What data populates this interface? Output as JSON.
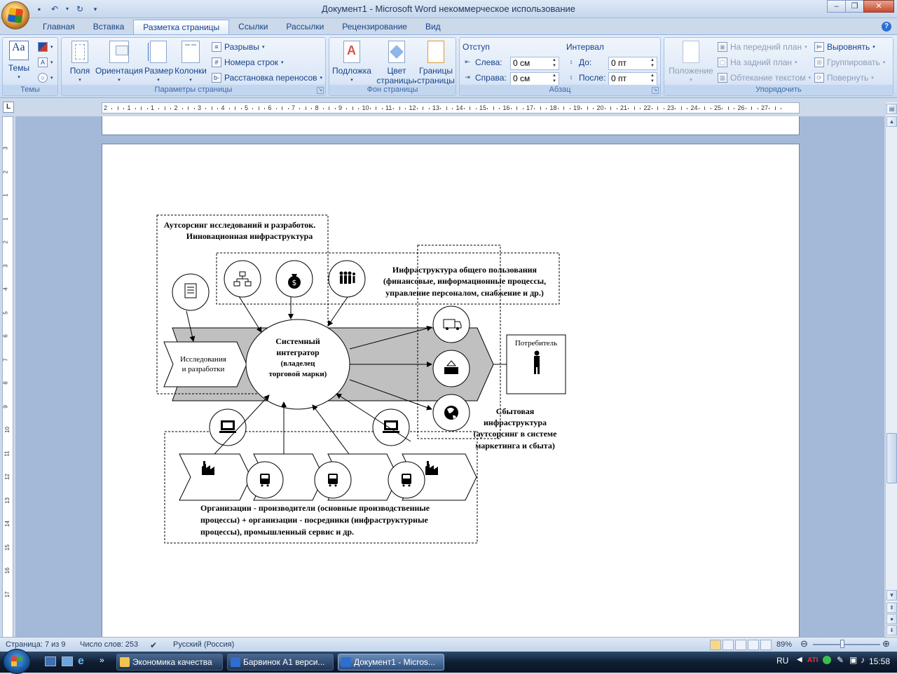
{
  "window": {
    "title": "Документ1 - Microsoft Word некоммерческое использование"
  },
  "ribbon": {
    "tabs": [
      "Главная",
      "Вставка",
      "Разметка страницы",
      "Ссылки",
      "Рассылки",
      "Рецензирование",
      "Вид"
    ],
    "active_tab": "Разметка страницы",
    "themes": {
      "label": "Темы",
      "button": "Темы"
    },
    "page_setup": {
      "label": "Параметры страницы",
      "fields": "Поля",
      "orientation": "Ориентация",
      "size": "Размер",
      "columns": "Колонки",
      "breaks": "Разрывы",
      "line_numbers": "Номера строк",
      "hyphenation": "Расстановка переносов"
    },
    "page_background": {
      "label": "Фон страницы",
      "watermark": "Подложка",
      "page_color_1": "Цвет",
      "page_color_2": "страницы",
      "page_borders_1": "Границы",
      "page_borders_2": "страницы"
    },
    "paragraph": {
      "label": "Абзац",
      "indent_title": "Отступ",
      "left_label": "Слева:",
      "left_value": "0 см",
      "right_label": "Справа:",
      "right_value": "0 см",
      "spacing_title": "Интервал",
      "before_label": "До:",
      "before_value": "0 пт",
      "after_label": "После:",
      "after_value": "0 пт"
    },
    "arrange": {
      "label": "Упорядочить",
      "position": "Положение",
      "bring_front": "На передний план",
      "send_back": "На задний план",
      "text_wrap": "Обтекание текстом",
      "align": "Выровнять",
      "group": "Группировать",
      "rotate": "Повернуть"
    }
  },
  "ruler": {
    "horizontal_ticks": [
      "2",
      "1",
      "1",
      "2",
      "3",
      "4",
      "5",
      "6",
      "7",
      "8",
      "9",
      "10",
      "11",
      "12",
      "13",
      "14",
      "15",
      "16",
      "17",
      "18",
      "19",
      "20",
      "21",
      "22",
      "23",
      "24",
      "25",
      "26",
      "27"
    ],
    "vertical_ticks": [
      "3",
      "2",
      "1",
      "1",
      "2",
      "3",
      "4",
      "5",
      "6",
      "7",
      "8",
      "9",
      "10",
      "11",
      "12",
      "13",
      "14",
      "15",
      "16",
      "17"
    ]
  },
  "diagram": {
    "rd_title_1": "Аутсорсинг исследований и разработок.",
    "rd_title_2": "Инновационная инфраструктура",
    "common_title_1": "Инфраструктура общего пользования",
    "common_title_2": "(финансовые, информационные процессы,",
    "common_title_3": "управление персоналом, снабжение и др.)",
    "research_1": "Исследования",
    "research_2": "и разработки",
    "integrator_1": "Системный",
    "integrator_2": "интегратор",
    "integrator_3": "(владелец",
    "integrator_4": "торговой марки)",
    "consumer": "Потребитель",
    "sales_1": "Сбытовая",
    "sales_2": "инфраструктура",
    "sales_3": "(аутсорсинг в системе",
    "sales_4": "маркетинга и сбыта)",
    "orgs_1": "Организации - производители (основные производственные",
    "orgs_2": "процессы) + организации - посредники (инфраструктурные",
    "orgs_3": "процессы), промышленный сервис и др."
  },
  "statusbar": {
    "page": "Страница: 7 из 9",
    "words": "Число слов: 253",
    "language": "Русский (Россия)",
    "zoom": "89%"
  },
  "taskbar": {
    "tasks": [
      "Экономика качества",
      "Барвинок А1 верси...",
      "Документ1 - Micros..."
    ],
    "lang": "RU",
    "clock": "15:58"
  }
}
